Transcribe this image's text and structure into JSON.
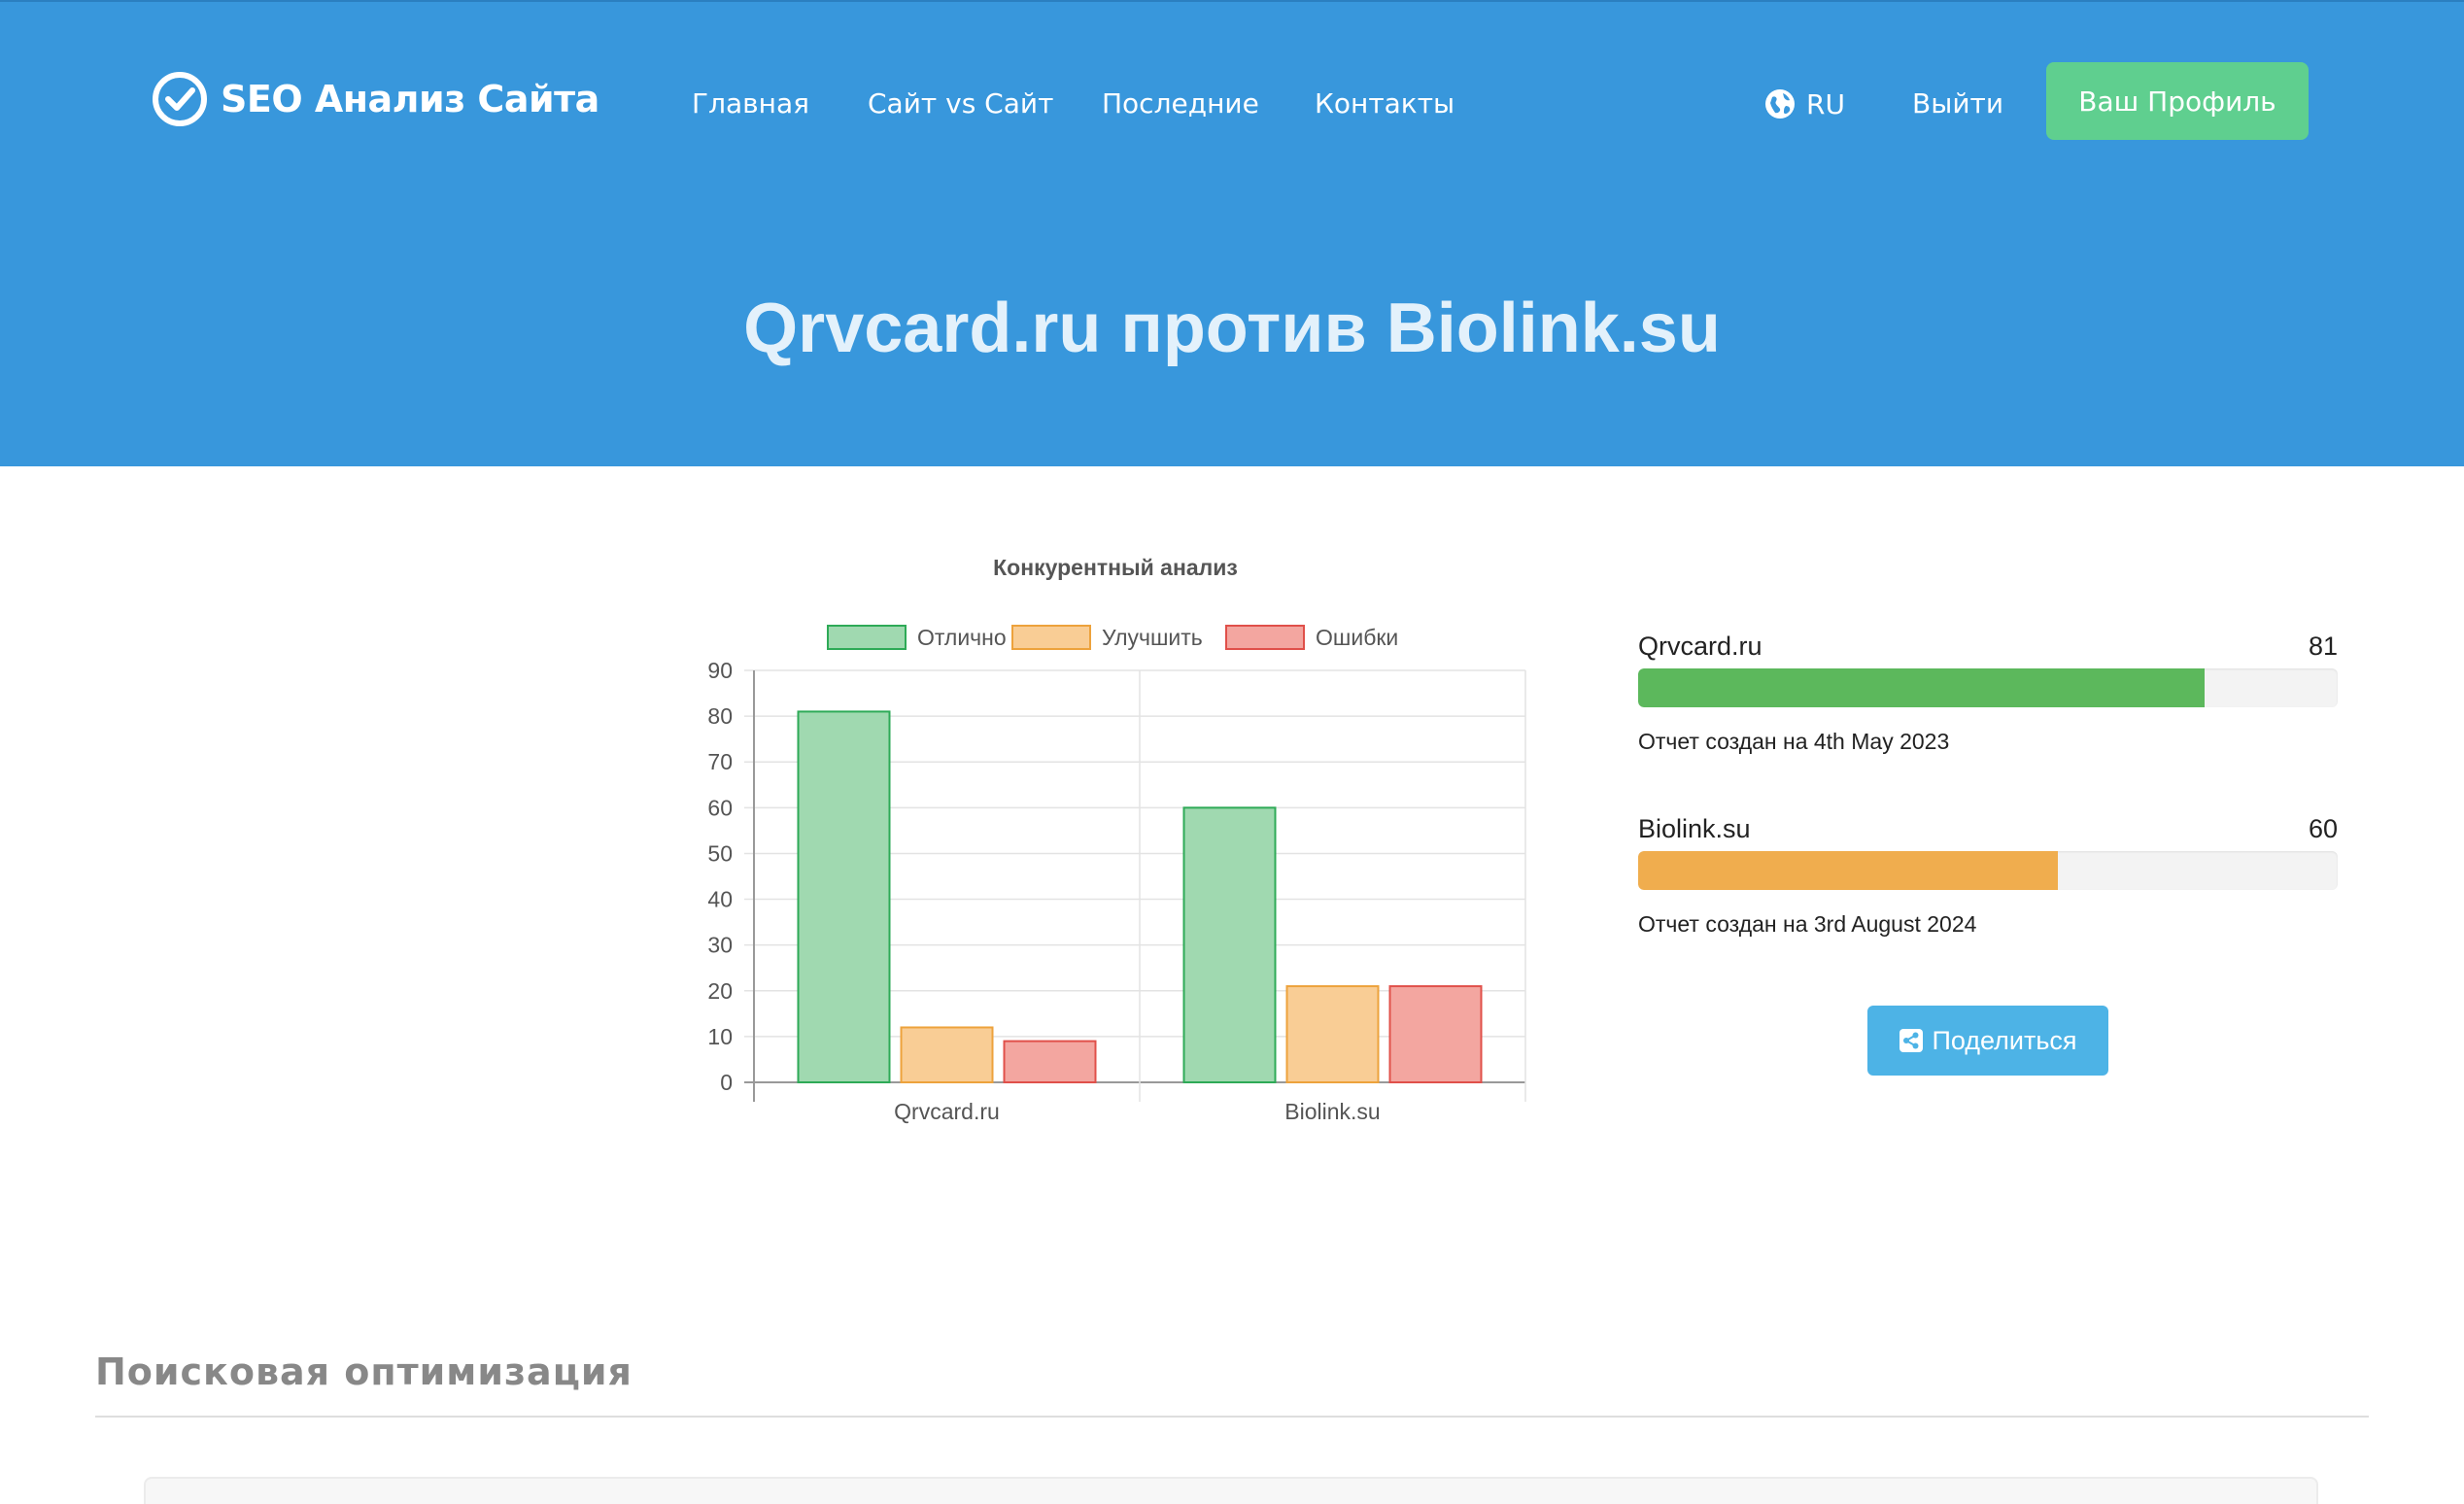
{
  "header": {
    "brand": "SEO Анализ Сайта",
    "brand_icon": "check-circle-icon",
    "nav": [
      {
        "label": "Главная"
      },
      {
        "label": "Сайт vs Сайт"
      },
      {
        "label": "Последние"
      },
      {
        "label": "Контакты"
      }
    ],
    "lang": {
      "icon": "globe-icon",
      "label": "RU"
    },
    "logout": "Выйти",
    "profile_button": "Ваш Профиль",
    "colors": {
      "background": "#3897dc",
      "profile_button": "#5fcf8f"
    }
  },
  "page_title": "Qrvcard.ru против Biolink.su",
  "chart_data": {
    "type": "bar",
    "title": "Конкурентный анализ",
    "categories": [
      "Qrvcard.ru",
      "Biolink.su"
    ],
    "series": [
      {
        "name": "Отлично",
        "values": [
          81,
          60
        ],
        "fill": "#a0d9b0",
        "stroke": "#2eaa57"
      },
      {
        "name": "Улучшить",
        "values": [
          12,
          21
        ],
        "fill": "#f9cd95",
        "stroke": "#eda23c"
      },
      {
        "name": "Ошибки",
        "values": [
          9,
          21
        ],
        "fill": "#f3a6a0",
        "stroke": "#e0504a"
      }
    ],
    "ylim": [
      0,
      90
    ],
    "yticks": [
      0,
      10,
      20,
      30,
      40,
      50,
      60,
      70,
      80,
      90
    ],
    "legend": "top",
    "grid": true
  },
  "scores": [
    {
      "site": "Qrvcard.ru",
      "score": 81,
      "percent": 81,
      "color": "#5cb85c",
      "report": "Отчет создан на 4th May 2023"
    },
    {
      "site": "Biolink.su",
      "score": 60,
      "percent": 60,
      "color": "#f0ad4e",
      "report": "Отчет создан на 3rd August 2024"
    }
  ],
  "share_button": {
    "label": "Поделиться",
    "icon": "share-icon"
  },
  "section": {
    "title": "Поисковая оптимизация"
  }
}
